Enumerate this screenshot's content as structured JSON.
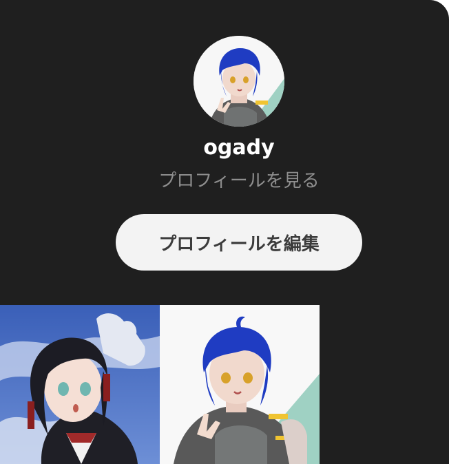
{
  "profile": {
    "username": "ogady",
    "view_profile_label": "プロフィールを見る",
    "edit_profile_label": "プロフィールを編集",
    "avatar_icon": "avatar-image"
  },
  "theme": {
    "panel_background": "#1f1f1f",
    "button_background": "#f3f3f3",
    "link_color": "#8e8e8e",
    "username_color": "#ffffff"
  },
  "posts": [
    {
      "icon": "post-thumbnail-girl-sky"
    },
    {
      "icon": "post-thumbnail-blue-hair-boy"
    }
  ]
}
